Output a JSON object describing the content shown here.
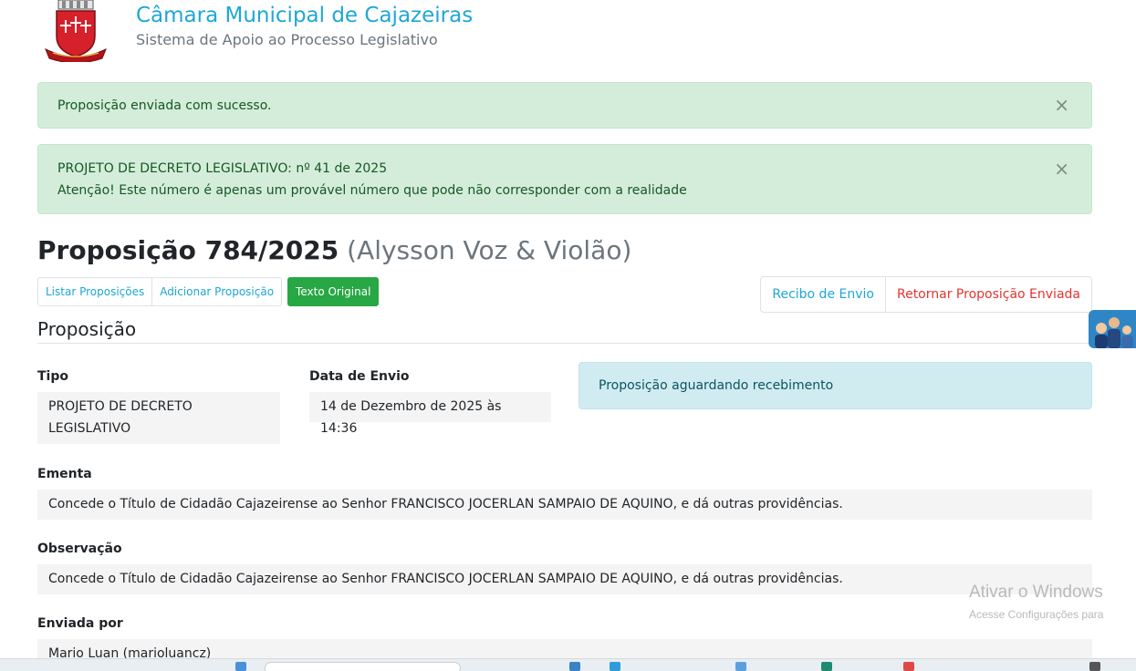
{
  "header": {
    "title": "Câmara Municipal de Cajazeiras",
    "subtitle": "Sistema de Apoio ao Processo Legislativo"
  },
  "alerts": [
    {
      "lines": [
        "Proposição enviada com sucesso."
      ],
      "close": "×"
    },
    {
      "lines": [
        "PROJETO DE DECRETO LEGISLATIVO: nº 41 de 2025",
        "Atenção! Este número é apenas um provável número que pode não corresponder com a realidade"
      ],
      "close": "×"
    }
  ],
  "page": {
    "title": "Proposição 784/2025",
    "author": "(Alysson Voz & Violão)"
  },
  "left_buttons": [
    "Listar Proposições",
    "Adicionar Proposição",
    "Texto Original"
  ],
  "right_buttons": [
    "Recibo de Envio",
    "Retornar Proposição Enviada"
  ],
  "section_title": "Proposição",
  "fields": {
    "tipo": {
      "label": "Tipo",
      "value_line1": "PROJETO DE DECRETO",
      "value_line2": "LEGISLATIVO"
    },
    "data_envio": {
      "label": "Data de Envio",
      "value": "14 de Dezembro de 2025 às 14:36"
    },
    "status": "Proposição aguardando recebimento",
    "ementa": {
      "label": "Ementa",
      "value": "Concede o Título de Cidadão Cajazeirense ao Senhor FRANCISCO JOCERLAN SAMPAIO DE AQUINO, e dá outras providências."
    },
    "observacao": {
      "label": "Observação",
      "value": "Concede o Título de Cidadão Cajazeirense ao Senhor FRANCISCO JOCERLAN SAMPAIO DE AQUINO, e dá outras providências."
    },
    "enviada_por": {
      "label": "Enviada por",
      "value": "Mario Luan (marioluancz)"
    }
  },
  "watermark": {
    "line1": "Ativar o Windows",
    "line2": "Acesse Configurações para"
  },
  "colors": {
    "brand": "#1ea7d6",
    "success_alert_bg": "#d4edda",
    "info_alert_bg": "#d1ecf1",
    "success_button": "#28a745",
    "danger_text": "#e3342f"
  }
}
